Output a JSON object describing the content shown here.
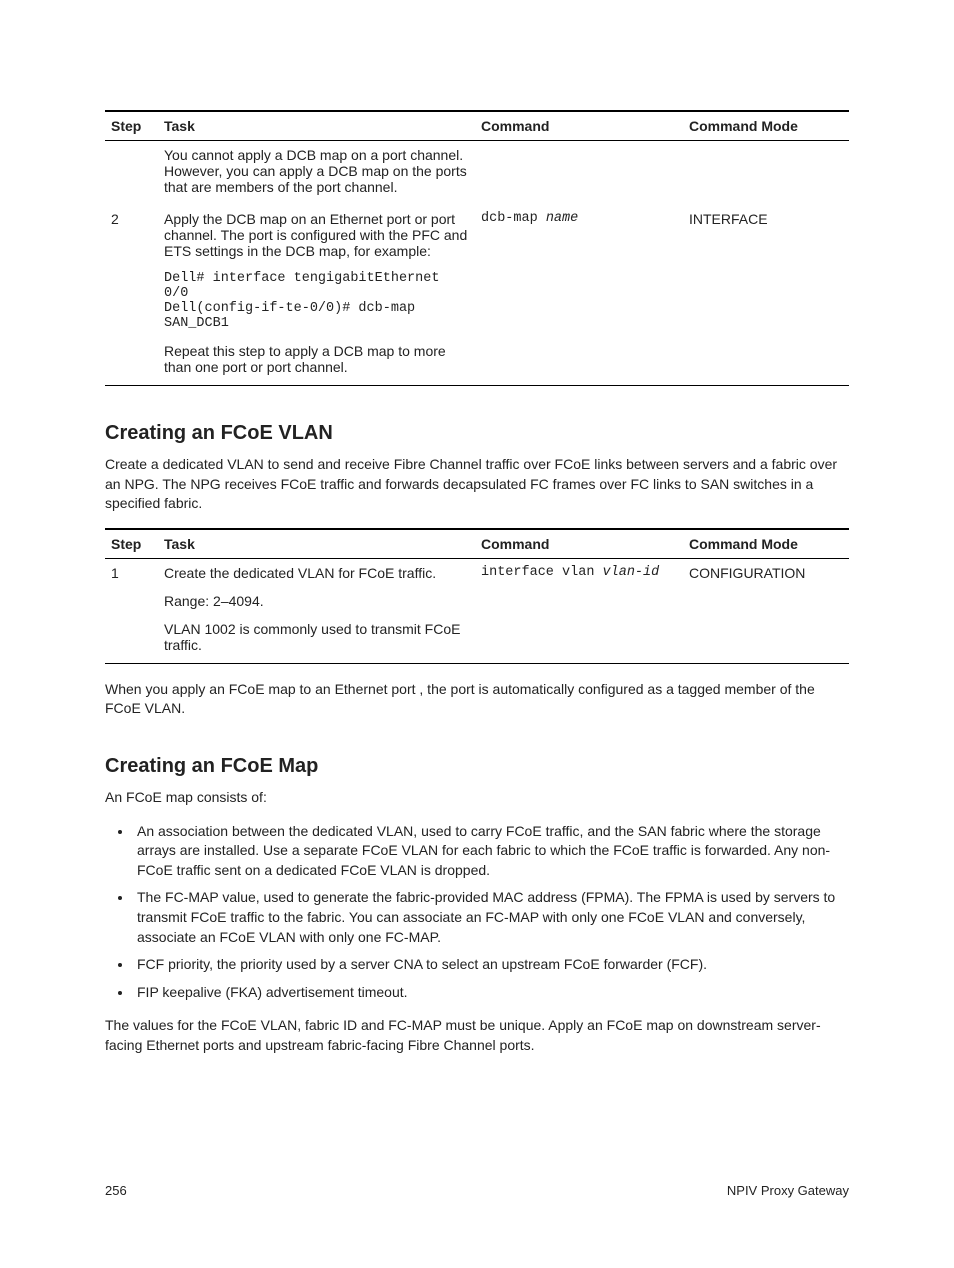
{
  "table1": {
    "headers": [
      "Step",
      "Task",
      "Command",
      "Command Mode"
    ],
    "rows": [
      {
        "step": "",
        "task": [
          {
            "type": "text",
            "content": "You cannot apply a DCB map on a port channel. However, you can apply a DCB map on the ports that are members of the port channel."
          }
        ],
        "command_plain": "",
        "command_italic": "",
        "mode": ""
      },
      {
        "step": "2",
        "task": [
          {
            "type": "text",
            "content": "Apply the DCB map on an Ethernet port or port channel. The port is configured with the PFC and ETS settings in the DCB map, for example:"
          },
          {
            "type": "code",
            "content": "Dell# interface tengigabitEthernet 0/0\nDell(config-if-te-0/0)# dcb-map SAN_DCB1"
          },
          {
            "type": "text",
            "content": "Repeat this step to apply a DCB map to more than one port or port channel."
          }
        ],
        "command_plain": "dcb-map ",
        "command_italic": "name",
        "mode": "INTERFACE"
      }
    ]
  },
  "section_vlan": {
    "heading": "Creating an FCoE VLAN",
    "intro": "Create a dedicated VLAN to send and receive Fibre Channel traffic over FCoE links between servers and a fabric over an NPG. The NPG receives FCoE traffic and forwards decapsulated FC frames over FC links to SAN switches in a specified fabric."
  },
  "table2": {
    "headers": [
      "Step",
      "Task",
      "Command",
      "Command Mode"
    ],
    "rows": [
      {
        "step": "1",
        "task": [
          {
            "type": "text",
            "content": "Create the dedicated VLAN for FCoE traffic."
          },
          {
            "type": "text",
            "content": "Range: 2–4094."
          },
          {
            "type": "text",
            "content": "VLAN 1002 is commonly used to transmit FCoE traffic."
          }
        ],
        "command_plain": "interface vlan ",
        "command_italic": "vlan-id",
        "mode": "CONFIGURATION"
      }
    ]
  },
  "after_table2": "When you apply an FCoE map to an Ethernet port , the port is automatically configured as a tagged member of the FCoE VLAN.",
  "section_map": {
    "heading": "Creating an FCoE Map",
    "intro": "An FCoE map consists of:",
    "bullets": [
      "An association between the dedicated VLAN, used to carry FCoE traffic, and the SAN fabric where the storage arrays are installed. Use a separate FCoE VLAN for each fabric to which the FCoE traffic is forwarded. Any non-FCoE traffic sent on a dedicated FCoE VLAN is dropped.",
      "The FC-MAP value, used to generate the fabric-provided MAC address (FPMA). The FPMA is used by servers to transmit FCoE traffic to the fabric. You can associate an FC-MAP with only one FCoE VLAN and conversely, associate an FCoE VLAN with only one FC-MAP.",
      "FCF priority, the priority used by a server CNA to select an upstream FCoE forwarder (FCF).",
      "FIP keepalive (FKA) advertisement timeout."
    ],
    "after": "The values for the FCoE VLAN, fabric ID and FC-MAP must be unique. Apply an FCoE map on downstream server-facing Ethernet ports and upstream fabric-facing Fibre Channel ports."
  },
  "footer": {
    "page_number": "256",
    "section_name": "NPIV Proxy Gateway"
  }
}
